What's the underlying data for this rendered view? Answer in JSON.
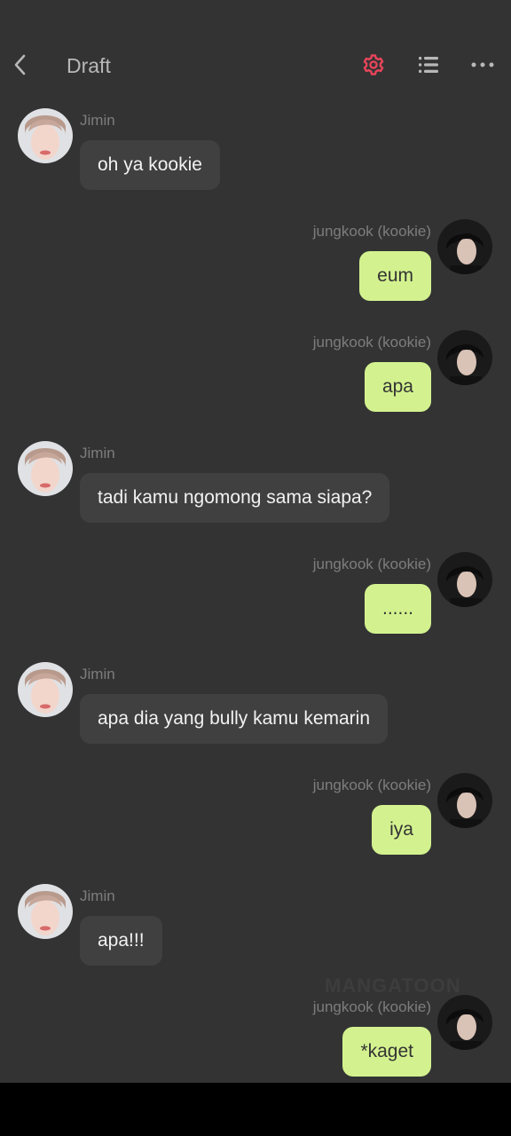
{
  "header": {
    "title": "Draft",
    "back_icon": "chevron-left-icon",
    "settings_icon": "gear-icon",
    "list_icon": "list-icon",
    "more_icon": "more-horizontal-icon",
    "accent_color": "#e8455a"
  },
  "colors": {
    "background": "#333334",
    "left_bubble": "#404041",
    "right_bubble": "#d3f28f"
  },
  "messages": [
    {
      "side": "left",
      "sender": "Jimin",
      "text": "oh ya kookie"
    },
    {
      "side": "right",
      "sender": "jungkook (kookie)",
      "text": "eum"
    },
    {
      "side": "right",
      "sender": "jungkook (kookie)",
      "text": "apa"
    },
    {
      "side": "left",
      "sender": "Jimin",
      "text": "tadi kamu ngomong sama siapa?"
    },
    {
      "side": "right",
      "sender": "jungkook (kookie)",
      "text": "......"
    },
    {
      "side": "left",
      "sender": "Jimin",
      "text": "apa dia yang bully kamu kemarin"
    },
    {
      "side": "right",
      "sender": "jungkook (kookie)",
      "text": "iya"
    },
    {
      "side": "left",
      "sender": "Jimin",
      "text": "apa!!!"
    },
    {
      "side": "right",
      "sender": "jungkook (kookie)",
      "text": "*kaget"
    }
  ],
  "watermark": "MANGATOON"
}
